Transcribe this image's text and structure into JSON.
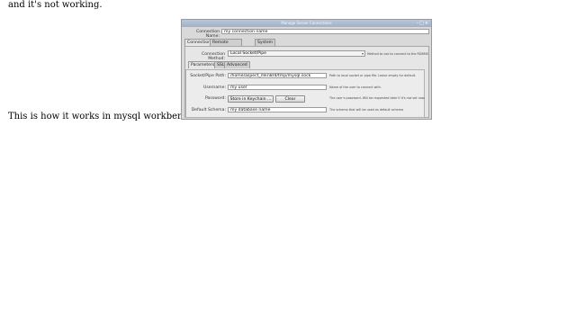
{
  "page": {
    "top_text": "and it's not working.",
    "inline_text": "This is how it works in mysql workbench:"
  },
  "dialog": {
    "title": "Manage Server Connections",
    "connection_name": {
      "label": "Connection Name:",
      "value": "my connection name"
    },
    "tabs": [
      "Connection",
      "Remote Management",
      "System Profile"
    ],
    "connection_method": {
      "label": "Connection Method:",
      "value": "Local Socket/Pipe",
      "help": "Method to use to connect to the RDBMS"
    },
    "sub_tabs": [
      "Parameters",
      "SSL",
      "Advanced"
    ],
    "socket_path": {
      "label": "Socket/Pipe Path:",
      "value": "/home/aspect_mkn8rd/tmp/mysql.sock",
      "help": "Path to local socket or pipe file. Leave empty for default."
    },
    "username": {
      "label": "Username:",
      "value": "my user",
      "help": "Name of the user to connect with."
    },
    "password": {
      "label": "Password:",
      "store_button": "Store in Keychain ...",
      "clear_button": "Clear",
      "help": "The user's password. Will be requested later if it's not set now."
    },
    "default_schema": {
      "label": "Default Schema:",
      "value": "my database name",
      "help": "The schema that will be used as default schema"
    }
  }
}
